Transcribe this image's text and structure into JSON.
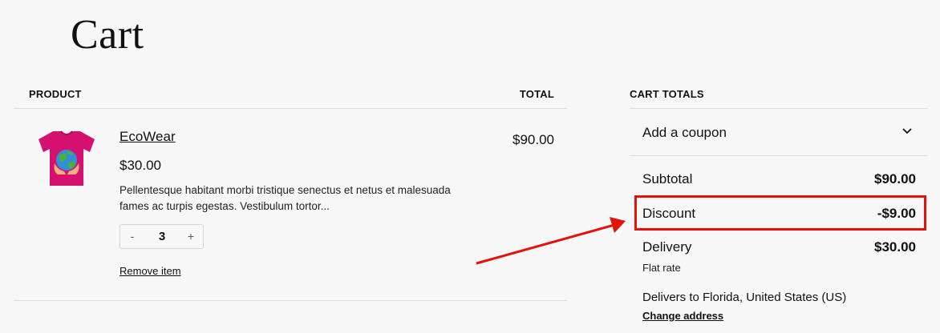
{
  "page": {
    "title": "Cart"
  },
  "cart_table": {
    "col_product": "PRODUCT",
    "col_total": "TOTAL",
    "item": {
      "name": "EcoWear",
      "price": "$30.00",
      "description": "Pellentesque habitant morbi tristique senectus et netus et malesuada fames ac turpis egestas. Vestibulum tortor...",
      "quantity": "3",
      "minus": "-",
      "plus": "+",
      "remove_label": "Remove item",
      "line_total": "$90.00",
      "image_icon": "tshirt-globe-icon"
    }
  },
  "totals": {
    "heading": "CART TOTALS",
    "coupon_label": "Add a coupon",
    "subtotal_label": "Subtotal",
    "subtotal_value": "$90.00",
    "discount_label": "Discount",
    "discount_value": "-$9.00",
    "delivery_label": "Delivery",
    "delivery_value": "$30.00",
    "delivery_method": "Flat rate",
    "delivers_to": "Delivers to Florida, United States (US)",
    "change_address": "Change address"
  },
  "colors": {
    "background": "#f7f7f7",
    "text": "#111111",
    "annotation_red": "#e3120b",
    "shirt": "#d5106f"
  }
}
